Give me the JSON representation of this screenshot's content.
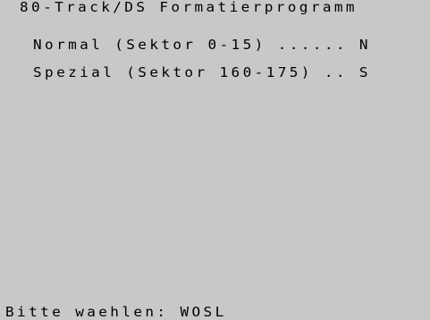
{
  "screen": {
    "title": "80-Track/DS Formatierprogramm",
    "menu": [
      {
        "label": "Normal (Sektor 0-15) ...... N"
      },
      {
        "label": "Spezial (Sektor 160-175) .. S"
      }
    ],
    "prompt": "Bitte waehlen: WOSL"
  },
  "colors": {
    "background": "#c8c8c8",
    "foreground": "#000000"
  }
}
